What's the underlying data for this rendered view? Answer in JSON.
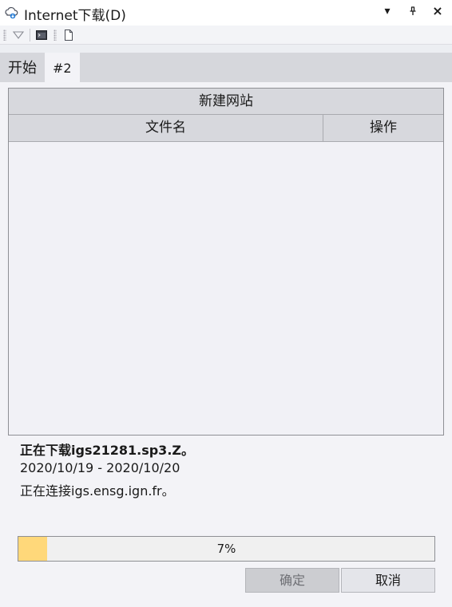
{
  "window": {
    "title": "Internet下载(D)",
    "controls": {
      "dropdown": "▾",
      "pin": "⊥",
      "close": "×"
    }
  },
  "toolbar": {
    "icons": [
      "dropdown-triangle-icon",
      "console-icon",
      "document-icon"
    ]
  },
  "tabs": [
    {
      "label": "开始",
      "active": false
    },
    {
      "label": "#2",
      "active": true
    }
  ],
  "site_box": {
    "title": "新建网站",
    "columns": [
      "文件名",
      "操作"
    ],
    "rows": []
  },
  "status": {
    "downloading": "正在下载igs21281.sp3.Z。",
    "date_range": "2020/10/19 - 2020/10/20",
    "connecting": "正在连接igs.ensg.ign.fr。"
  },
  "progress": {
    "percent": 7,
    "label": "7%"
  },
  "buttons": {
    "ok": "确定",
    "cancel": "取消"
  },
  "colors": {
    "progress_fill": "#ffd87a",
    "panel": "#f3f3f7",
    "tabstrip": "#d6d7dc"
  }
}
